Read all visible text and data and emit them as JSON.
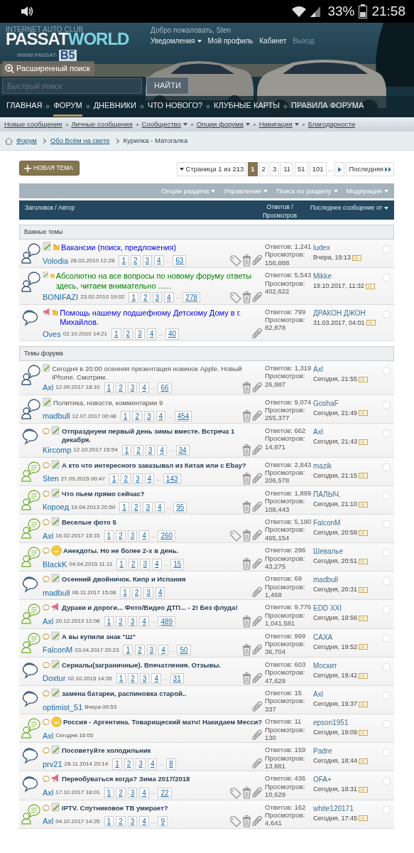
{
  "status_bar": {
    "battery": "33%",
    "time": "21:58"
  },
  "header": {
    "tagline": "INTERNET AUTO CLUB",
    "logo_main": "PASSAT",
    "logo_accent": "WORLD",
    "logo_site": "WWW.PASSAT-",
    "logo_badge": "B5",
    "welcome": "Добро пожаловать, Sten",
    "user_links": [
      {
        "label": "Уведомления",
        "dropdown": true,
        "dim": false
      },
      {
        "label": "Мой профиль",
        "dropdown": false,
        "dim": false
      },
      {
        "label": "Кабинет",
        "dropdown": false,
        "dim": false
      },
      {
        "label": "Выход",
        "dropdown": false,
        "dim": true
      }
    ],
    "advanced_search": "Расширенный поиск",
    "search": {
      "placeholder": "Быстрый поиск"
    },
    "search_button": "НАЙТИ"
  },
  "nav": [
    {
      "label": "ГЛАВНАЯ",
      "selected": false
    },
    {
      "label": "ФОРУМ",
      "selected": true
    },
    {
      "label": "ДНЕВНИКИ",
      "selected": false
    },
    {
      "label": "ЧТО НОВОГО?",
      "selected": false
    },
    {
      "label": "КЛУБНЫЕ КАРТЫ",
      "selected": false
    },
    {
      "label": "ПРАВИЛА ФОРУМА",
      "selected": false
    }
  ],
  "subnav": [
    {
      "label": "Новые сообщения",
      "dropdown": false
    },
    {
      "label": "Личные сообщения",
      "dropdown": false
    },
    {
      "label": "Сообщество",
      "dropdown": true
    },
    {
      "label": "Опции форума",
      "dropdown": true
    },
    {
      "label": "Навигация",
      "dropdown": true
    },
    {
      "label": "Благодарности",
      "dropdown": false
    }
  ],
  "breadcrumb": [
    "Форум",
    "Обо Всём на свете",
    "Курилка - Матогалка"
  ],
  "new_topic": "НОВАЯ ТЕМА",
  "pagination": {
    "summary": "Страница 1 из 213",
    "pages": [
      {
        "label": "1",
        "selected": true
      },
      {
        "label": "2",
        "selected": false
      },
      {
        "label": "3",
        "selected": false
      },
      {
        "label": "11",
        "selected": false
      },
      {
        "label": "51",
        "selected": false
      },
      {
        "label": "101",
        "selected": false
      }
    ],
    "gap": "...",
    "last": "Последняя"
  },
  "tools": [
    "Опции раздела",
    "Управление",
    "Поиск по разделу",
    "Модерация"
  ],
  "columns": [
    "Заголовок / Автор",
    "Ответов / Просмотров",
    "Последнее сообщение от"
  ],
  "sections": [
    {
      "title": "Важные темы",
      "threads": [
        {
          "kind": "person",
          "unread": false,
          "prefix": {
            "kind": "pencil"
          },
          "sticky": true,
          "title": "Вакансии (поиск, предложения)",
          "color": "#0000ee",
          "author": "Volodia",
          "date": "26.02.2010 12:28",
          "pages": [
            "1",
            "2",
            "3",
            "4"
          ],
          "gap": "...",
          "last_page": "63",
          "tagged": true,
          "trash": true,
          "replies": "Ответов: 1,241",
          "views": "Просмотров: 156,888",
          "last_by": "ludex",
          "last_time": "Вчера, 19:13",
          "checked": false
        },
        {
          "kind": "person",
          "unread": false,
          "prefix": {
            "kind": "pencil"
          },
          "sticky": true,
          "title": "Абсолютно на все вопросы по новому форуму ответы здесь, читаем внимательно ......",
          "color": "#008000",
          "author": "BONIFAZI",
          "date": "23.02.2010 19:02",
          "pages": [
            "1",
            "2",
            "3",
            "4"
          ],
          "gap": "...",
          "last_page": "278",
          "tagged": true,
          "trash": true,
          "replies": "Ответов: 5,543",
          "views": "Просмотров: 402,622",
          "last_by": "Mikke",
          "last_time": "19.10.2017, 11:32",
          "checked": false
        },
        {
          "kind": "bubbles",
          "unread": false,
          "prefix": {
            "kind": "megaphone"
          },
          "sticky": true,
          "title": "Помощь нашему подшефному Детскому Дому в г. Михайлов.",
          "color": "#0000ee",
          "author": "Oves",
          "date": "02.10.2010 14:21",
          "pages": [
            "1",
            "2",
            "3",
            "4"
          ],
          "gap": "...",
          "last_page": "40",
          "tagged": false,
          "trash": false,
          "replies": "Ответов: 799",
          "views": "Просмотров: 82,878",
          "last_by": "ДРАКОН ДЖОН",
          "last_time": "31.03.2017, 04:01",
          "checked": false
        }
      ]
    },
    {
      "title": "Темы форума",
      "threads": [
        {
          "kind": "person",
          "unread": false,
          "prefix": {
            "kind": "pencil"
          },
          "sticky": false,
          "title": "Сегодня в 20:00 осенняя презентация новинок Apple. Новый iPhone. Смотрим.",
          "author": "Axl",
          "date": "12.09.2017 18:10",
          "pages": [
            "1",
            "2",
            "3",
            "4"
          ],
          "gap": "...",
          "last_page": "66",
          "tagged": false,
          "trash": true,
          "replies": "Ответов: 1,319",
          "views": "Просмотров: 26,887",
          "last_by": "Axl",
          "last_time": "Сегодня, 21:55",
          "checked": false
        },
        {
          "kind": "person",
          "unread": false,
          "prefix": {
            "kind": "pencil"
          },
          "sticky": false,
          "title": "Политика, новости, комментарии 9",
          "author": "madbull",
          "date": "12.07.2017 00:48",
          "pages": [
            "1",
            "2",
            "3",
            "4"
          ],
          "gap": "...",
          "last_page": "454",
          "tagged": false,
          "trash": true,
          "replies": "Ответов: 9,074",
          "views": "Просмотров: 255,377",
          "last_by": "GoshaF",
          "last_time": "Сегодня, 21:49",
          "checked": false
        },
        {
          "kind": "bubbles",
          "unread": true,
          "prefix": {
            "kind": "pencil"
          },
          "sticky": false,
          "title": "Отпразднуем первый день зимы вместе. Встреча 1 декабря.",
          "author": "Kircomp",
          "date": "12.10.2017 15:54",
          "pages": [
            "1",
            "2",
            "3",
            "4"
          ],
          "gap": "...",
          "last_page": "34",
          "tagged": false,
          "trash": true,
          "replies": "Ответов: 662",
          "views": "Просмотров: 14,871",
          "last_by": "Axl",
          "last_time": "Сегодня, 21:43",
          "checked": false
        },
        {
          "kind": "person-new",
          "unread": true,
          "prefix": {
            "kind": "pencil"
          },
          "sticky": false,
          "title": "А кто что интересного заказывал из Китая или с Ebay?",
          "author": "Sten",
          "date": "27.09.2015 00:47",
          "pages": [
            "1",
            "2",
            "3",
            "4"
          ],
          "gap": "...",
          "last_page": "143",
          "tagged": false,
          "trash": true,
          "replies": "Ответов: 2,843",
          "views": "Просмотров: 206,578",
          "last_by": "mazik",
          "last_time": "Сегодня, 21:15",
          "checked": false
        },
        {
          "kind": "person-new",
          "unread": true,
          "prefix": {
            "kind": "pencil"
          },
          "sticky": false,
          "title": "Что пьем прямо сейчас?",
          "author": "Короед",
          "date": "19.04.2013 20:50",
          "pages": [
            "1",
            "2",
            "3",
            "4"
          ],
          "gap": "...",
          "last_page": "95",
          "tagged": false,
          "trash": true,
          "replies": "Ответов: 1,899",
          "views": "Просмотров: 108,443",
          "last_by": "ПАЛЫЧ.",
          "last_time": "Сегодня, 21:10",
          "checked": false
        },
        {
          "kind": "person-new",
          "unread": true,
          "prefix": {
            "kind": "pencil"
          },
          "sticky": false,
          "title": "Веселые фото 5",
          "author": "Axl",
          "date": "16.02.2017 15:15",
          "pages": [
            "1",
            "2",
            "3",
            "4"
          ],
          "gap": "...",
          "last_page": "260",
          "tagged": true,
          "trash": true,
          "replies": "Ответов: 5,190",
          "views": "Просмотров: 465,154",
          "last_by": "FalconM",
          "last_time": "Сегодня, 20:59",
          "checked": false
        },
        {
          "kind": "person-new",
          "unread": true,
          "prefix": {
            "kind": "smiley"
          },
          "sticky": false,
          "title": "Анекдоты. Но не более 2-х в день.",
          "author": "BlackK",
          "date": "04.04.2015 11:11",
          "pages": [
            "1",
            "2",
            "3",
            "4"
          ],
          "gap": "...",
          "last_page": "15",
          "tagged": false,
          "trash": true,
          "replies": "Ответов: 296",
          "views": "Просмотров: 43,275",
          "last_by": "Шевалье",
          "last_time": "Сегодня, 20:51",
          "checked": false
        },
        {
          "kind": "bubbles",
          "unread": true,
          "prefix": {
            "kind": "pencil"
          },
          "sticky": false,
          "title": "Осенний двойничок. Кипр и Испания",
          "author": "madbull",
          "date": "06.11.2017 15:08",
          "pages": [
            "1",
            "2",
            "3",
            "4"
          ],
          "tagged": false,
          "trash": false,
          "replies": "Ответов: 69",
          "views": "Просмотров: 1,468",
          "last_by": "madbull",
          "last_time": "Сегодня, 20:31",
          "checked": false
        },
        {
          "kind": "person-new",
          "unread": true,
          "prefix": {
            "kind": "megaphone"
          },
          "sticky": false,
          "title": "Дураки и дороги... Фото/Видео ДТП... - 2! Без флуда!",
          "author": "Axl",
          "date": "20.12.2013 12:08",
          "pages": [
            "1",
            "2",
            "3",
            "4"
          ],
          "gap": "...",
          "last_page": "489",
          "tagged": false,
          "trash": true,
          "replies": "Ответов: 9,776",
          "views": "Просмотров: 1,041,581",
          "last_by": "EDD XXI",
          "last_time": "Сегодня, 19:56",
          "checked": false
        },
        {
          "kind": "person-new",
          "unread": true,
          "prefix": {
            "kind": "pencil"
          },
          "sticky": false,
          "title": "А вы купили знак \"Ш\"",
          "author": "FalconM",
          "date": "03.04.2017 20:23",
          "pages": [
            "1",
            "2",
            "3",
            "4"
          ],
          "gap": "...",
          "last_page": "50",
          "tagged": false,
          "trash": true,
          "replies": "Ответов: 999",
          "views": "Просмотров: 36,704",
          "last_by": "CAXA",
          "last_time": "Сегодня, 19:52",
          "checked": false
        },
        {
          "kind": "bubbles",
          "unread": true,
          "prefix": {
            "kind": "pencil"
          },
          "sticky": false,
          "title": "Сериалы(заграничные). Впечатления. Отзывы.",
          "author": "Doxtur",
          "date": "02.10.2015 14:35",
          "pages": [
            "1",
            "2",
            "3",
            "4"
          ],
          "gap": "...",
          "last_page": "31",
          "tagged": false,
          "trash": true,
          "replies": "Ответов: 603",
          "views": "Просмотров: 47,629",
          "last_by": "Москит",
          "last_time": "Сегодня, 19:42",
          "checked": false
        },
        {
          "kind": "bubbles",
          "unread": true,
          "prefix": {
            "kind": "pencil"
          },
          "sticky": false,
          "title": "замена батареи, распиновка старой..",
          "author": "optimist_51",
          "date": "Вчера 09:53",
          "tagged": false,
          "trash": false,
          "replies": "Ответов: 15",
          "views": "Просмотров: 337",
          "last_by": "Axl",
          "last_time": "Сегодня, 19:37",
          "checked": false
        },
        {
          "kind": "person-new",
          "unread": true,
          "prefix": {
            "kind": "smiley"
          },
          "sticky": false,
          "title": "Россия - Аргентина. Товарищеский матч! Накидаем Месси?",
          "author": "Axl",
          "date": "Сегодня 16:05",
          "tagged": false,
          "trash": false,
          "replies": "Ответов: 11",
          "views": "Просмотров: 130",
          "last_by": "epson1951",
          "last_time": "Сегодня, 19:09",
          "checked": false
        },
        {
          "kind": "bubbles",
          "unread": true,
          "prefix": {
            "kind": "pencil"
          },
          "sticky": false,
          "title": "Посоветуйте холодильник",
          "author": "prv21",
          "date": "28.11.2014 20:14",
          "pages": [
            "1",
            "2",
            "3",
            "4"
          ],
          "gap": "...",
          "last_page": "8",
          "tagged": false,
          "trash": false,
          "replies": "Ответов: 159",
          "views": "Просмотров: 13,881",
          "last_by": "Padre",
          "last_time": "Сегодня, 18:44",
          "checked": false
        },
        {
          "kind": "bubbles",
          "unread": true,
          "prefix": {
            "kind": "megaphone"
          },
          "sticky": false,
          "title": "Переобуваться когда? Зима 2017/2018",
          "author": "Axl",
          "date": "17.10.2017 18:01",
          "pages": [
            "1",
            "2",
            "3",
            "4"
          ],
          "gap": "...",
          "last_page": "22",
          "tagged": true,
          "trash": true,
          "replies": "Ответов: 436",
          "views": "Просмотров: 10,629",
          "last_by": "OFA+",
          "last_time": "Сегодня, 18:31",
          "checked": false
        },
        {
          "kind": "person-new",
          "unread": true,
          "prefix": {
            "kind": "pencil"
          },
          "sticky": false,
          "title": "IPTV. Спутниковое ТВ умирает?",
          "author": "Axl",
          "date": "04.10.2017 14:25",
          "pages": [
            "1",
            "2",
            "3",
            "4"
          ],
          "gap": "...",
          "last_page": "9",
          "tagged": true,
          "trash": true,
          "replies": "Ответов: 162",
          "views": "Просмотров: 4,641",
          "last_by": "white120171",
          "last_time": "Сегодня, 17:45",
          "checked": false
        }
      ]
    }
  ]
}
